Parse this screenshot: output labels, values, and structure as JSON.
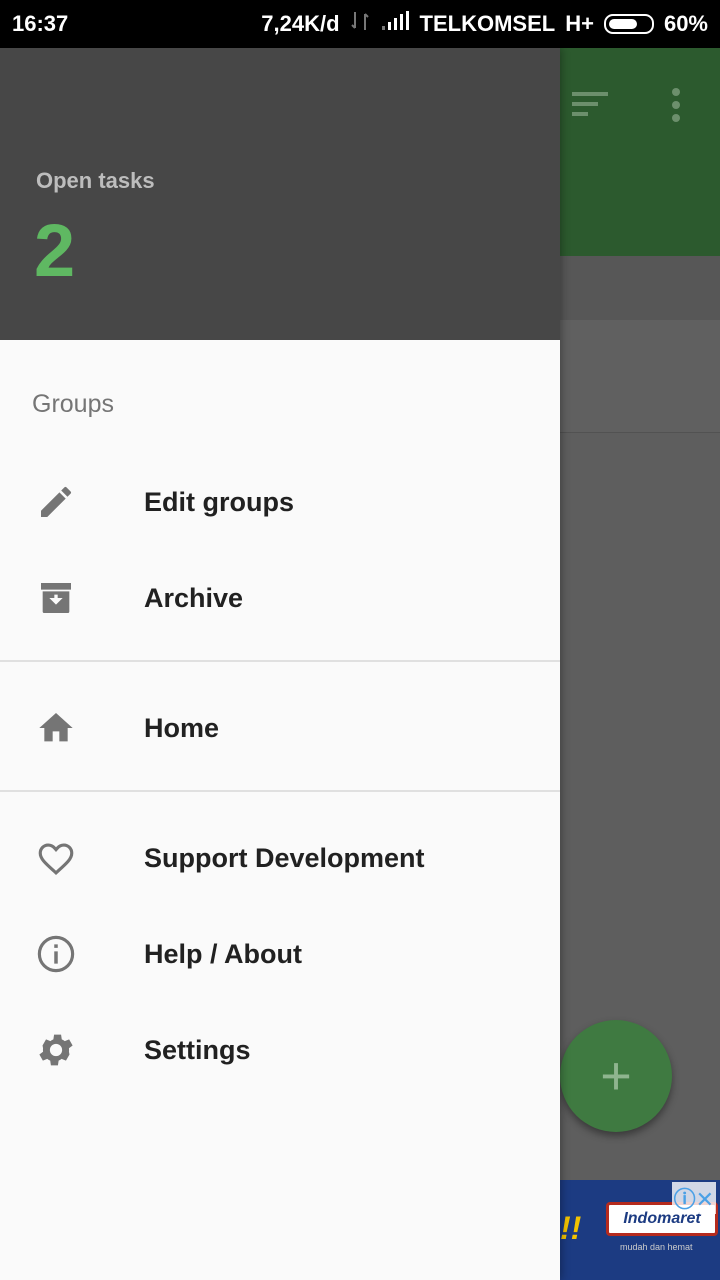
{
  "status_bar": {
    "time": "16:37",
    "network_speed": "7,24K/d",
    "carrier": "TELKOMSEL",
    "network_type": "H+",
    "battery": "60%"
  },
  "drawer": {
    "header": {
      "label": "Open tasks",
      "count": "2"
    },
    "section_title": "Groups",
    "items": [
      {
        "label": "Edit groups",
        "icon": "pencil-icon"
      },
      {
        "label": "Archive",
        "icon": "archive-icon"
      },
      {
        "label": "Home",
        "icon": "home-icon"
      },
      {
        "label": "Support Development",
        "icon": "heart-icon"
      },
      {
        "label": "Help / About",
        "icon": "info-icon"
      },
      {
        "label": "Settings",
        "icon": "gear-icon"
      }
    ]
  },
  "background_app": {
    "fab_symbol": "+",
    "ad": {
      "brand": "Indomaret",
      "tagline": "mudah dan hemat",
      "badge": "ⓘ✕"
    }
  },
  "colors": {
    "header_bg": "#474747",
    "accent_green": "#5fb862",
    "drawer_bg": "#fafafa",
    "toolbar_green": "#2c5a2e"
  }
}
